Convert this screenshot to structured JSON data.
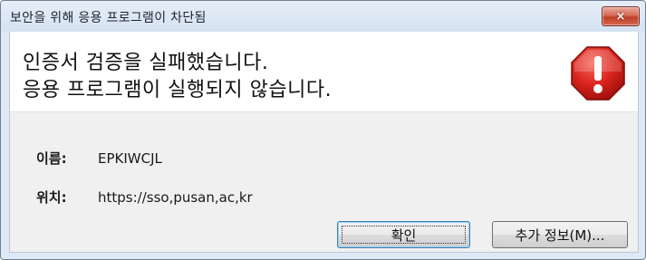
{
  "window": {
    "title": "보안을 위해 응용 프로그램이 차단됨",
    "close_glyph": "×"
  },
  "message": {
    "line1": "인증서 검증을 실패했습니다.",
    "line2": "응용 프로그램이 실행되지 않습니다."
  },
  "details": {
    "name_label": "이름:",
    "name_value": "EPKIWCJL",
    "location_label": "위치:",
    "location_value": "https://sso,pusan,ac,kr"
  },
  "buttons": {
    "ok_label": "확인",
    "more_info_label": "추가 정보(M)..."
  },
  "colors": {
    "warning_red": "#d0201b",
    "close_red": "#c94a34",
    "titlebar": "#dbe6f3"
  },
  "icons": {
    "warning": "exclamation-octagon-icon",
    "close": "close-icon"
  }
}
